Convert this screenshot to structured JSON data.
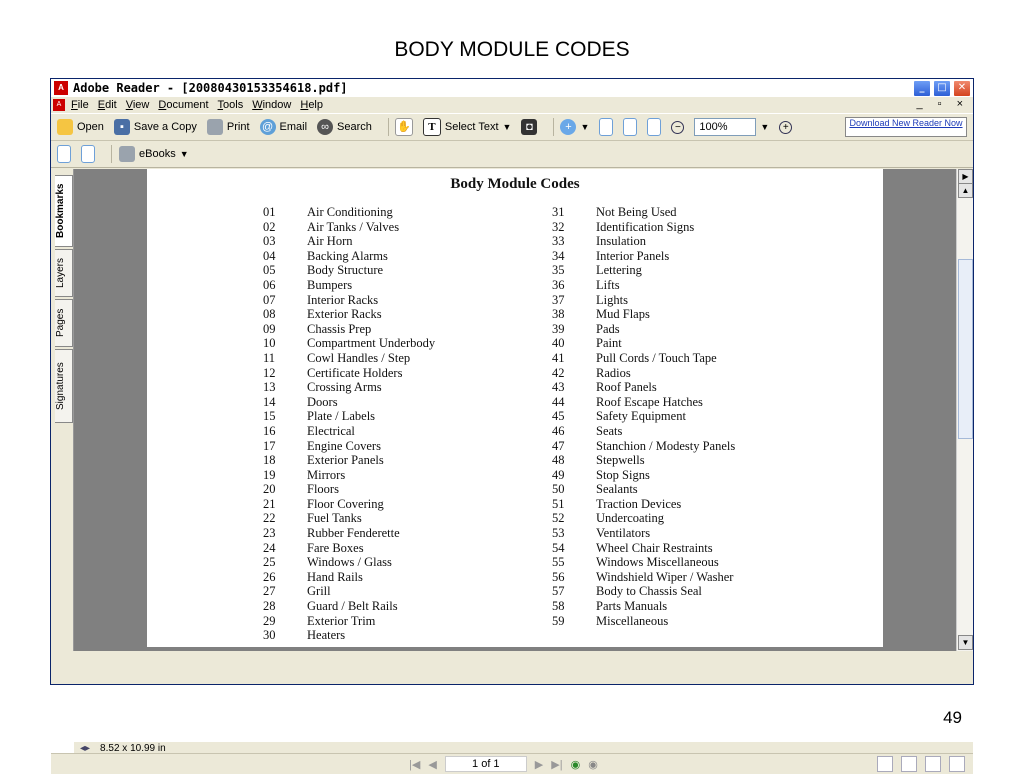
{
  "slide": {
    "title": "BODY MODULE CODES",
    "number": "49"
  },
  "window": {
    "title": "Adobe Reader - [20080430153354618.pdf]",
    "controls": {
      "minimize": "_",
      "maximize": "□",
      "close": "✕"
    }
  },
  "menu": [
    "File",
    "Edit",
    "View",
    "Document",
    "Tools",
    "Window",
    "Help"
  ],
  "mdi_controls": "_ ▫ ×",
  "toolbar": {
    "open": "Open",
    "save": "Save a Copy",
    "print": "Print",
    "email": "Email",
    "search": "Search",
    "select_text": "Select Text",
    "zoom_value": "100%",
    "download": "Download New Reader Now"
  },
  "toolbar2": {
    "ebooks": "eBooks"
  },
  "nav_tabs": [
    "Bookmarks",
    "Layers",
    "Pages",
    "Signatures"
  ],
  "document": {
    "title": "Body Module Codes",
    "left_codes": [
      [
        "01",
        "Air Conditioning"
      ],
      [
        "02",
        "Air Tanks / Valves"
      ],
      [
        "03",
        "Air Horn"
      ],
      [
        "04",
        "Backing Alarms"
      ],
      [
        "05",
        "Body Structure"
      ],
      [
        "06",
        "Bumpers"
      ],
      [
        "07",
        "Interior Racks"
      ],
      [
        "08",
        "Exterior Racks"
      ],
      [
        "09",
        "Chassis Prep"
      ],
      [
        "10",
        "Compartment Underbody"
      ],
      [
        "11",
        "Cowl Handles / Step"
      ],
      [
        "12",
        "Certificate Holders"
      ],
      [
        "13",
        "Crossing Arms"
      ],
      [
        "14",
        "Doors"
      ],
      [
        "15",
        "Plate / Labels"
      ],
      [
        "16",
        "Electrical"
      ],
      [
        "17",
        "Engine Covers"
      ],
      [
        "18",
        "Exterior Panels"
      ],
      [
        "19",
        "Mirrors"
      ],
      [
        "20",
        "Floors"
      ],
      [
        "21",
        "Floor Covering"
      ],
      [
        "22",
        "Fuel Tanks"
      ],
      [
        "23",
        "Rubber Fenderette"
      ],
      [
        "24",
        "Fare Boxes"
      ],
      [
        "25",
        "Windows / Glass"
      ],
      [
        "26",
        "Hand Rails"
      ],
      [
        "27",
        "Grill"
      ],
      [
        "28",
        "Guard / Belt Rails"
      ],
      [
        "29",
        "Exterior Trim"
      ],
      [
        "30",
        "Heaters"
      ]
    ],
    "right_codes": [
      [
        "31",
        "Not Being Used"
      ],
      [
        "32",
        "Identification Signs"
      ],
      [
        "33",
        "Insulation"
      ],
      [
        "34",
        "Interior Panels"
      ],
      [
        "35",
        "Lettering"
      ],
      [
        "36",
        "Lifts"
      ],
      [
        "37",
        "Lights"
      ],
      [
        "38",
        "Mud Flaps"
      ],
      [
        "39",
        "Pads"
      ],
      [
        "40",
        "Paint"
      ],
      [
        "41",
        "Pull Cords / Touch Tape"
      ],
      [
        "42",
        "Radios"
      ],
      [
        "43",
        "Roof Panels"
      ],
      [
        "44",
        "Roof Escape Hatches"
      ],
      [
        "45",
        "Safety Equipment"
      ],
      [
        "46",
        "Seats"
      ],
      [
        "47",
        "Stanchion / Modesty Panels"
      ],
      [
        "48",
        "Stepwells"
      ],
      [
        "49",
        "Stop Signs"
      ],
      [
        "50",
        "Sealants"
      ],
      [
        "51",
        "Traction Devices"
      ],
      [
        "52",
        "Undercoating"
      ],
      [
        "53",
        "Ventilators"
      ],
      [
        "54",
        "Wheel Chair Restraints"
      ],
      [
        "55",
        "Windows Miscellaneous"
      ],
      [
        "56",
        "Windshield Wiper / Washer"
      ],
      [
        "57",
        "Body to Chassis Seal"
      ],
      [
        "58",
        "Parts Manuals"
      ],
      [
        "59",
        "Miscellaneous"
      ]
    ]
  },
  "status": {
    "page_size": "8.52 x 10.99 in",
    "page_indicator": "1 of 1"
  }
}
